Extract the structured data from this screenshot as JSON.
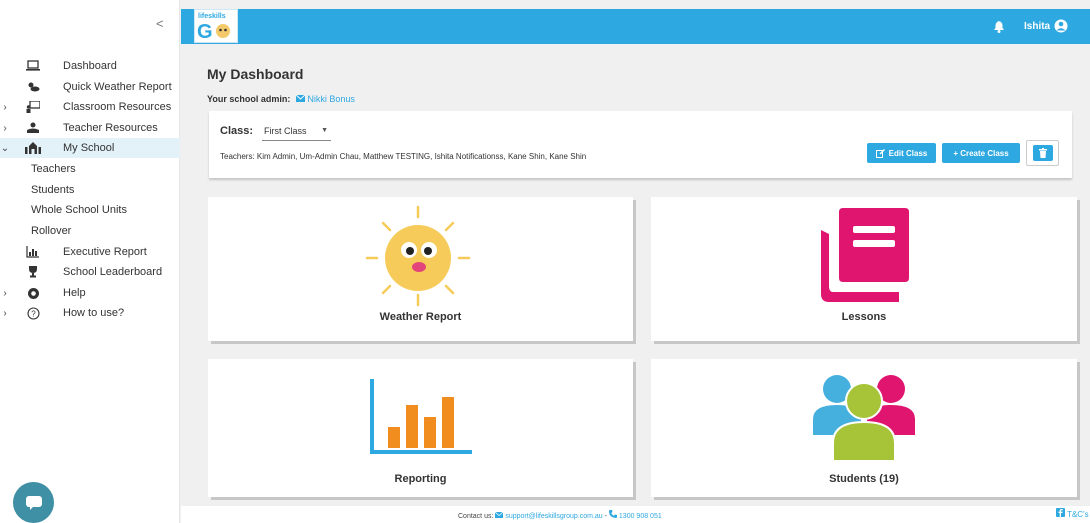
{
  "sidebar": {
    "collapse_label": "<",
    "items": [
      {
        "label": "Dashboard"
      },
      {
        "label": "Quick Weather Report"
      },
      {
        "label": "Classroom Resources"
      },
      {
        "label": "Teacher Resources"
      },
      {
        "label": "My School"
      },
      {
        "label": "Executive Report"
      },
      {
        "label": "School Leaderboard"
      },
      {
        "label": "Help"
      },
      {
        "label": "How to use?"
      }
    ],
    "subitems": [
      "Teachers",
      "Students",
      "Whole School Units",
      "Rollover"
    ]
  },
  "header": {
    "logo_text": "lifeskills",
    "logo_go": "GO",
    "user_name": "Ishita"
  },
  "main": {
    "title": "My Dashboard",
    "admin_label": "Your school admin:",
    "admin_name": "Nikki Bonus",
    "class_label": "Class:",
    "class_selected": "First Class",
    "teachers_text": "Teachers: Kim Admin, Um-Admin Chau, Matthew TESTING, Ishita Notificationss, Kane Shin, Kane Shin",
    "edit_class_label": "Edit Class",
    "create_class_label": "+ Create Class"
  },
  "tiles": {
    "weather": "Weather Report",
    "lessons": "Lessons",
    "reporting": "Reporting",
    "students": "Students (19)"
  },
  "footer": {
    "contact_label": "Contact us:",
    "email": "support@lifeskillsgroup.com.au",
    "separator": "-",
    "phone": "1300 908 051",
    "tcs": "T&C's"
  },
  "colors": {
    "accent": "#2ea8e0",
    "lessons": "#e0156f",
    "reporting_bar": "#f08d1e",
    "students_green": "#a7c439",
    "students_blue": "#45b0dd",
    "students_pink": "#e0156f"
  }
}
